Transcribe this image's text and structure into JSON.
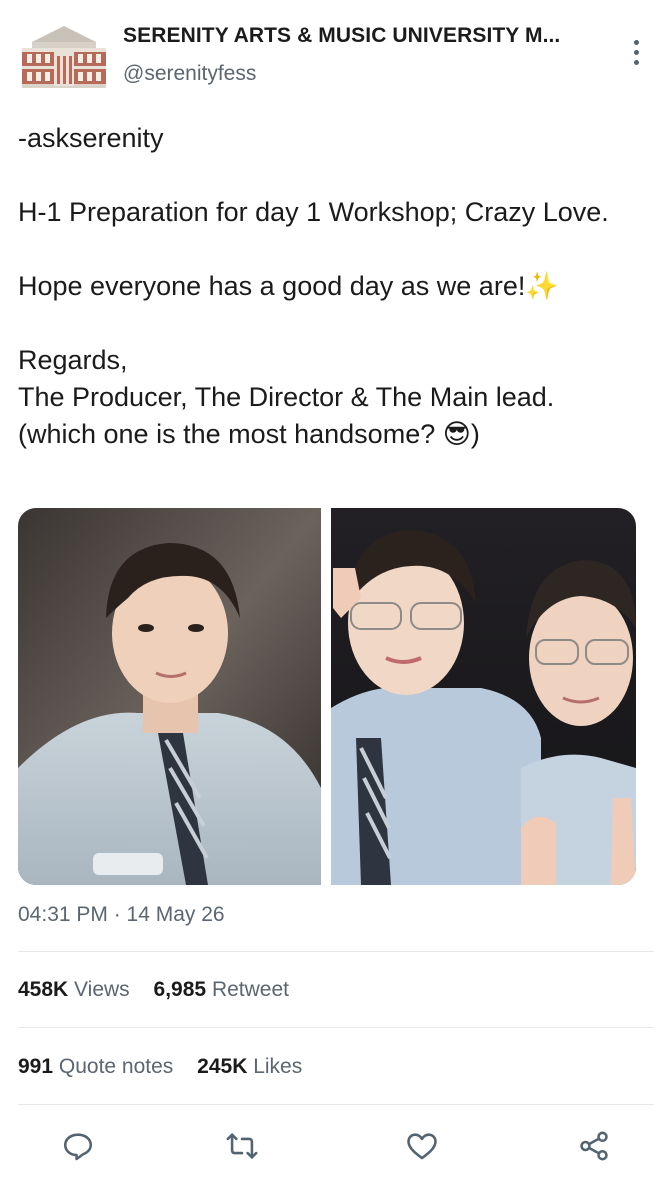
{
  "account": {
    "name": "SERENITY ARTS & MUSIC UNIVERSITY M...",
    "handle": "@serenityfess"
  },
  "tweet": {
    "lines": [
      "-askserenity",
      "H-1 Preparation for day 1 Workshop; Crazy Love.",
      "Hope everyone has a good day as we are!✨",
      "Regards,",
      "The Producer, The Director & The Main lead.",
      "(which one is the most handsome? 😎)"
    ],
    "timestamp": "04:31 PM · 14 May 26"
  },
  "stats": {
    "views_count": "458K",
    "views_label": "Views",
    "retweet_count": "6,985",
    "retweet_label": "Retweet",
    "quote_count": "991",
    "quote_label": "Quote notes",
    "likes_count": "245K",
    "likes_label": "Likes"
  },
  "icons": {
    "reply": "reply-icon",
    "retweet": "retweet-icon",
    "like": "like-icon",
    "share": "share-icon",
    "more": "more-icon"
  },
  "colors": {
    "text": "#1b1b1b",
    "muted": "#5b6670",
    "divider": "#e4e8eb",
    "action": "#536471"
  }
}
